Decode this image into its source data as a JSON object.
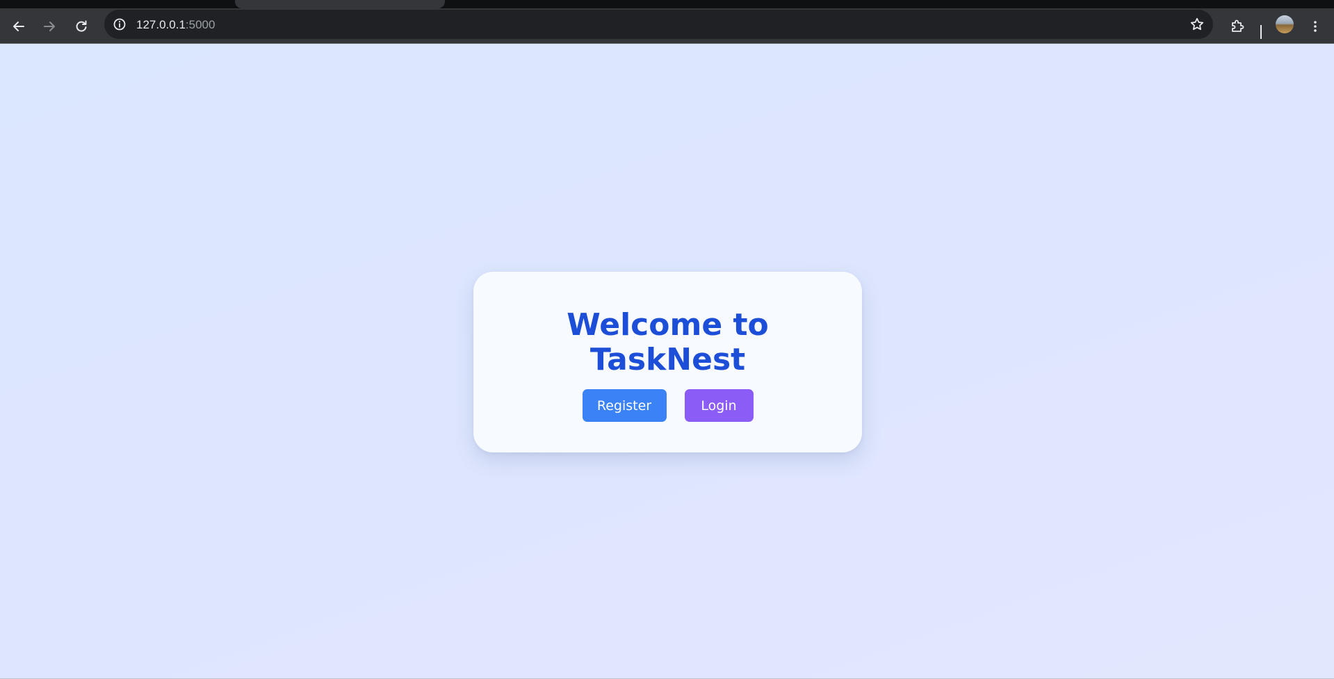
{
  "browser": {
    "url_host": "127.0.0.1",
    "url_port": ":5000",
    "icons": {
      "back": "back-arrow-icon",
      "forward": "forward-arrow-icon",
      "reload": "reload-icon",
      "site_info": "info-icon",
      "bookmark": "star-icon",
      "extensions": "puzzle-icon",
      "menu": "kebab-menu-icon"
    }
  },
  "page": {
    "title_line1": "Welcome to",
    "title_line2": "TaskNest",
    "register_label": "Register",
    "login_label": "Login"
  },
  "colors": {
    "page_background": "#dfe8fd",
    "card_background": "#f7faff",
    "title": "#1d4ed8",
    "register_button": "#3b82f6",
    "login_button": "#8b5cf6"
  }
}
